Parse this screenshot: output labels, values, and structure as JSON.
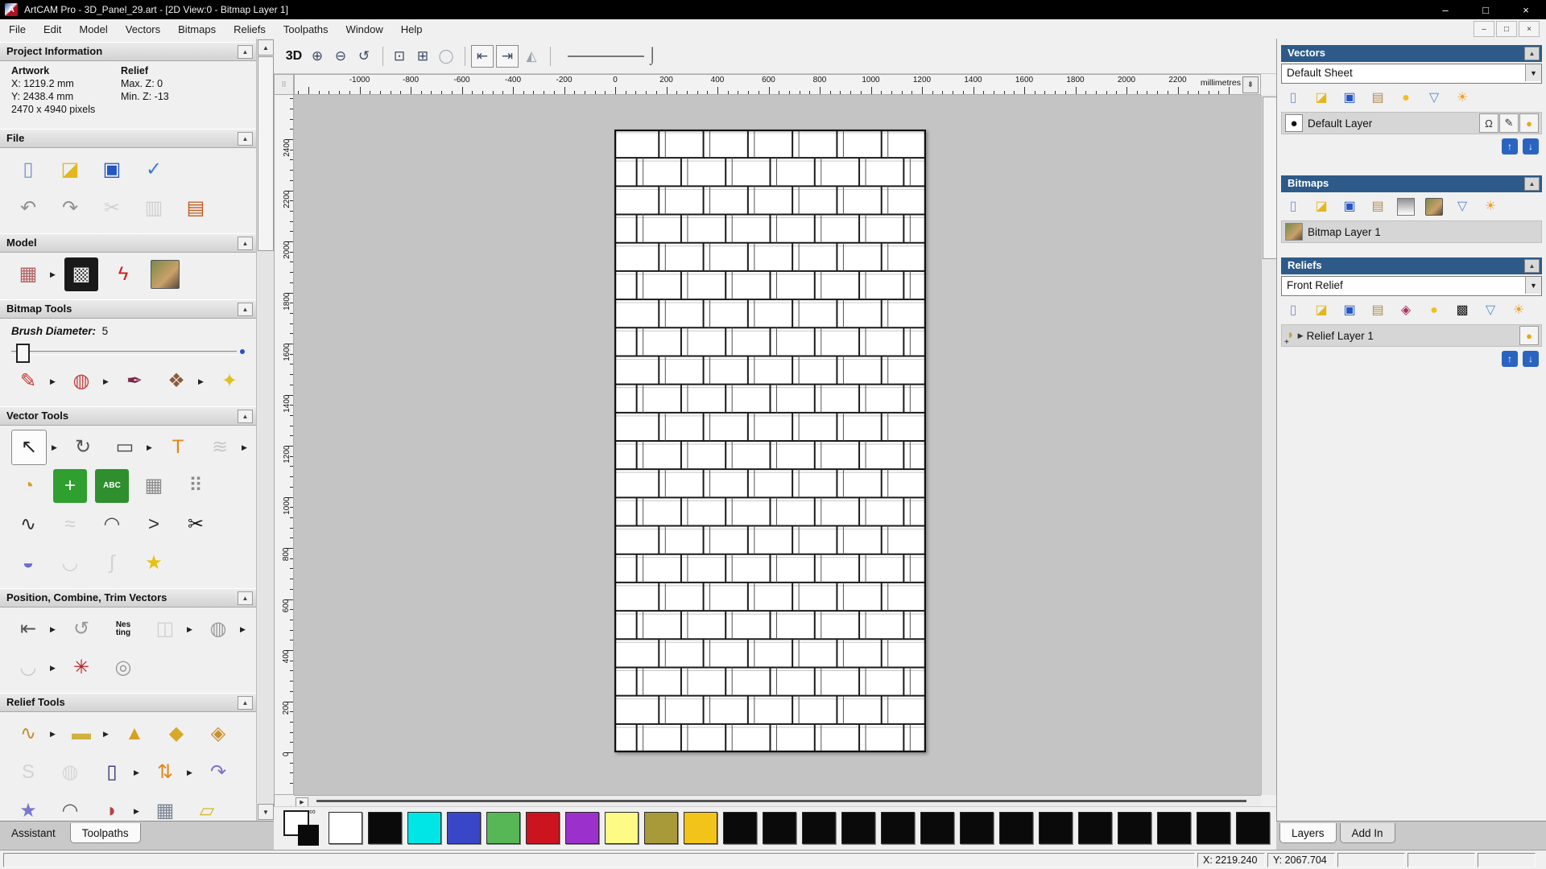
{
  "window": {
    "title": "ArtCAM Pro - 3D_Panel_29.art - [2D View:0 - Bitmap Layer 1]",
    "logo_letter": "A",
    "minimize": "–",
    "maximize": "□",
    "close": "×"
  },
  "menu": {
    "items": [
      "File",
      "Edit",
      "Model",
      "Vectors",
      "Bitmaps",
      "Reliefs",
      "Toolpaths",
      "Window",
      "Help"
    ],
    "mdi": [
      "–",
      "□",
      "×"
    ]
  },
  "assistant": {
    "project_information": {
      "title": "Project Information",
      "artwork_label": "Artwork",
      "artwork_x": "X: 1219.2 mm",
      "artwork_y": "Y: 2438.4 mm",
      "artwork_pixels": "2470 x 4940 pixels",
      "relief_label": "Relief",
      "relief_max": "Max. Z: 0",
      "relief_min": "Min. Z: -13"
    },
    "sections": {
      "file": {
        "title": "File",
        "rows": [
          [
            {
              "n": "new-model",
              "g": "▯",
              "c": "#7b96c8"
            },
            {
              "n": "open-model",
              "g": "◪",
              "c": "#e3b71e"
            },
            {
              "n": "save-model",
              "g": "▣",
              "c": "#2456c4"
            },
            {
              "n": "model-options",
              "g": "✓",
              "c": "#3f7ad0"
            }
          ],
          [
            {
              "n": "undo",
              "g": "↶",
              "c": "#909090"
            },
            {
              "n": "redo",
              "g": "↷",
              "c": "#909090"
            },
            {
              "n": "cut",
              "g": "✂",
              "c": "#aaaaaa",
              "dim": 1
            },
            {
              "n": "copy",
              "g": "▥",
              "c": "#aaaaaa",
              "dim": 1
            },
            {
              "n": "paste",
              "g": "▤",
              "c": "#c25a20"
            }
          ]
        ]
      },
      "model": {
        "title": "Model",
        "rows": [
          [
            {
              "n": "set-model-size",
              "g": "▦",
              "c": "#b06060",
              "fly": 1
            },
            {
              "n": "invert-model",
              "g": "▩",
              "c": "#f0f0f0",
              "bg": "#1a1a1a"
            },
            {
              "n": "set-lighting",
              "g": "ϟ",
              "c": "#cc2020"
            },
            {
              "n": "load-image",
              "art": 1
            }
          ]
        ]
      },
      "bitmap_tools": {
        "title": "Bitmap Tools",
        "brush_label": "Brush Diameter:",
        "brush_value": "5",
        "rows": [
          [
            {
              "n": "paint-tool",
              "g": "✎",
              "c": "#c43030",
              "fly": 1
            },
            {
              "n": "flood-fill",
              "g": "◍",
              "c": "#c44040",
              "fly": 1
            },
            {
              "n": "colour-picker",
              "g": "✒",
              "c": "#7a2a4a"
            },
            {
              "n": "colour-palette",
              "g": "❖",
              "c": "#8a5a3a",
              "fly": 1
            },
            {
              "n": "magic-wand",
              "g": "✦",
              "c": "#e0c020"
            }
          ]
        ]
      },
      "vector_tools": {
        "title": "Vector Tools",
        "rows": [
          [
            {
              "n": "select-vectors",
              "g": "↖",
              "c": "#222222",
              "active": 1,
              "fly": 1
            },
            {
              "n": "transform-vectors",
              "g": "↻",
              "c": "#555555"
            },
            {
              "n": "create-rectangle",
              "g": "▭",
              "c": "#444444",
              "fly": 1
            },
            {
              "n": "create-text",
              "g": "T",
              "c": "#e08818"
            },
            {
              "n": "fit-vectors-to-bitmap",
              "g": "≋",
              "c": "#999999",
              "dim": 1,
              "fly": 1
            }
          ],
          [
            {
              "n": "measure-tool",
              "g": "◔",
              "c": "#d8a020"
            },
            {
              "n": "block-copy-rotate",
              "g": "+",
              "c": "#ffffff",
              "bg": "#2f9f2f"
            },
            {
              "n": "paste-text",
              "txt": "ABC",
              "bg": "#2f8f2f",
              "c": "#ffffff"
            },
            {
              "n": "envelope-distortion",
              "g": "▦",
              "c": "#8a8a8a"
            },
            {
              "n": "block-paste",
              "g": "⠿",
              "c": "#8a8a8a"
            }
          ],
          [
            {
              "n": "create-polyline",
              "g": "∿",
              "c": "#333333"
            },
            {
              "n": "freehand-draw",
              "g": "≈",
              "c": "#aaaaaa",
              "dim": 1
            },
            {
              "n": "create-arc",
              "g": "◠",
              "c": "#444444"
            },
            {
              "n": "sharpen-corner",
              "g": ">",
              "c": "#333333"
            },
            {
              "n": "trim-vectors",
              "g": "✂",
              "c": "#111111"
            }
          ],
          [
            {
              "n": "create-boundary",
              "g": "◒",
              "c": "#6a6ad0"
            },
            {
              "n": "fit-arcs",
              "g": "◡",
              "c": "#aaaaaa",
              "dim": 1
            },
            {
              "n": "join-vectors",
              "g": "∫",
              "c": "#aaaaaa",
              "dim": 1
            },
            {
              "n": "create-star",
              "g": "★",
              "c": "#e8c010"
            }
          ]
        ]
      },
      "position_vectors": {
        "title": "Position, Combine, Trim Vectors",
        "rows": [
          [
            {
              "n": "align-vectors",
              "g": "⇤",
              "c": "#555555",
              "fly": 1
            },
            {
              "n": "text-on-curve",
              "g": "↺",
              "c": "#999999"
            },
            {
              "n": "nesting",
              "txt": "Nes\nting",
              "c": "#111111"
            },
            {
              "n": "group-vectors",
              "g": "◫",
              "c": "#aaaaaa",
              "dim": 1,
              "fly": 1
            },
            {
              "n": "weld-vectors",
              "g": "◍",
              "c": "#999999",
              "fly": 1
            }
          ],
          [
            {
              "n": "fillet-tool",
              "g": "◡",
              "c": "#999999",
              "dim": 1,
              "fly": 1
            },
            {
              "n": "vector-texture",
              "g": "✳",
              "c": "#bb2222"
            },
            {
              "n": "interlocking-vectors",
              "g": "◎",
              "c": "#999999"
            }
          ]
        ]
      },
      "relief_tools": {
        "title": "Relief Tools",
        "rows": [
          [
            {
              "n": "smooth-relief",
              "g": "∿",
              "c": "#c09030",
              "fly": 1
            },
            {
              "n": "zero-plane",
              "g": "▬",
              "c": "#d0b040",
              "fly": 1
            },
            {
              "n": "add-relief",
              "g": "▲",
              "c": "#d8a020"
            },
            {
              "n": "merge-highest",
              "g": "◆",
              "c": "#d8a828"
            },
            {
              "n": "merge-lowest",
              "g": "◈",
              "c": "#c89030"
            }
          ],
          [
            {
              "n": "sculpt",
              "g": "S",
              "c": "#b0b0b0",
              "dim": 1
            },
            {
              "n": "celtic-weave",
              "g": "◍",
              "c": "#b8b8b8",
              "dim": 1
            },
            {
              "n": "offset-relief",
              "g": "▯",
              "c": "#32327a",
              "fly": 1
            },
            {
              "n": "scale-relief-height",
              "g": "⇅",
              "c": "#e08818",
              "fly": 1
            },
            {
              "n": "relief-envelope",
              "g": "↷",
              "c": "#8070c8"
            }
          ],
          [
            {
              "n": "shape-editor",
              "g": "★",
              "c": "#7878d0"
            },
            {
              "n": "two-rail-sweep",
              "g": "◠",
              "c": "#555555"
            },
            {
              "n": "extrude-relief",
              "g": "◗",
              "c": "#b84040",
              "fly": 1
            },
            {
              "n": "texture-relief",
              "g": "▦",
              "c": "#7a8494"
            },
            {
              "n": "relief-layer-stack",
              "g": "▱",
              "c": "#d0b830"
            }
          ],
          [
            {
              "n": "angled-plane",
              "g": "◢",
              "c": "#bb2020"
            },
            {
              "n": "relief-weave",
              "g": "▦",
              "c": "#909090"
            },
            {
              "n": "smooth-blend",
              "g": "◉",
              "c": "#8888cc"
            },
            {
              "n": "textured-sphere",
              "g": "●",
              "c": "#3a5ac0"
            },
            {
              "n": "relief-split",
              "g": "❖",
              "c": "#c0a020"
            }
          ]
        ]
      }
    },
    "tabs": [
      {
        "label": "Assistant",
        "active": true
      },
      {
        "label": "Toolpaths",
        "active": false
      }
    ]
  },
  "view_toolbar": {
    "buttons": [
      {
        "t": "btn",
        "n": "view-3d",
        "label": "3D"
      },
      {
        "t": "btn",
        "n": "zoom-in",
        "g": "⊕"
      },
      {
        "t": "btn",
        "n": "zoom-out",
        "g": "⊖"
      },
      {
        "t": "btn",
        "n": "zoom-previous",
        "g": "↺"
      },
      {
        "t": "sep"
      },
      {
        "t": "btn",
        "n": "zoom-box",
        "g": "⊡"
      },
      {
        "t": "btn",
        "n": "zoom-fit",
        "g": "⊞"
      },
      {
        "t": "btn",
        "n": "zoom-selection",
        "g": "◯",
        "dim": 1
      },
      {
        "t": "sep"
      },
      {
        "t": "btn",
        "n": "previous-bitmap-layer",
        "g": "⇤",
        "boxed": 1
      },
      {
        "t": "btn",
        "n": "next-bitmap-layer",
        "g": "⇥",
        "boxed": 1
      },
      {
        "t": "btn",
        "n": "preview-relief",
        "g": "◭",
        "dim": 1
      },
      {
        "t": "sep"
      },
      {
        "t": "slider",
        "n": "line-width-slider"
      }
    ]
  },
  "ruler": {
    "unit": "millimetres",
    "h_labels": [
      -1000,
      -800,
      -600,
      -400,
      -200,
      0,
      200,
      400,
      600,
      800,
      1000,
      1200,
      1400,
      1600,
      1800,
      2000,
      2200
    ],
    "v_labels": [
      2400,
      2200,
      2000,
      1800,
      1600,
      1400,
      1200,
      1000,
      800,
      600,
      400,
      200,
      0
    ]
  },
  "canvas": {
    "weave": {
      "rows": 22,
      "cols": 7
    }
  },
  "palette": {
    "primary": "#ffffff",
    "secondary": "#0a0a0a",
    "swatches": [
      "#ffffff",
      "#0a0a0a",
      "#00e6e6",
      "#3a46c8",
      "#57b757",
      "#cc1420",
      "#9b30cc",
      "#fdfa86",
      "#a89a38",
      "#f2c41a",
      "#0a0a0a",
      "#0a0a0a",
      "#0a0a0a",
      "#0a0a0a",
      "#0a0a0a",
      "#0a0a0a",
      "#0a0a0a",
      "#0a0a0a",
      "#0a0a0a",
      "#0a0a0a",
      "#0a0a0a",
      "#0a0a0a",
      "#0a0a0a",
      "#0a0a0a"
    ]
  },
  "layers_panel": {
    "vectors": {
      "title": "Vectors",
      "sheet": "Default Sheet",
      "toolbar": [
        [
          {
            "n": "new-vector-layer",
            "g": "▯",
            "c": "#7b96c8"
          },
          {
            "n": "open-vector-layer",
            "g": "◪",
            "c": "#e3b71e"
          },
          {
            "n": "save-vector-layer",
            "g": "▣",
            "c": "#2456c4"
          },
          {
            "n": "merge-vector-layers",
            "g": "▤",
            "c": "#b08a50"
          },
          {
            "n": "toggle-layer-visibility",
            "g": "●",
            "c": "#f0c020"
          },
          {
            "n": "delete-vector-layer",
            "g": "▽",
            "c": "#5588cc"
          },
          {
            "n": "toggle-all-layers",
            "g": "☀",
            "c": "#f0a020"
          }
        ]
      ],
      "layer_name": "Default Layer"
    },
    "bitmaps": {
      "title": "Bitmaps",
      "toolbar": [
        [
          {
            "n": "new-bitmap-layer",
            "g": "▯",
            "c": "#7b96c8"
          },
          {
            "n": "open-bitmap-layer",
            "g": "◪",
            "c": "#e3b71e"
          },
          {
            "n": "save-bitmap-layer",
            "g": "▣",
            "c": "#2456c4"
          },
          {
            "n": "merge-bitmap-layers",
            "g": "▤",
            "c": "#b08a50"
          },
          {
            "n": "colour-fade",
            "grad": 1
          },
          {
            "n": "bitmap-fill",
            "art": 1
          },
          {
            "n": "delete-bitmap-layer",
            "g": "▽",
            "c": "#5588cc"
          },
          {
            "n": "toggle-all-bitmaps",
            "g": "☀",
            "c": "#f0a020"
          }
        ]
      ],
      "layer_name": "Bitmap Layer 1"
    },
    "reliefs": {
      "title": "Reliefs",
      "dropdown": "Front Relief",
      "toolbar": [
        [
          {
            "n": "new-relief-layer",
            "g": "▯",
            "c": "#7b96c8"
          },
          {
            "n": "open-relief-layer",
            "g": "◪",
            "c": "#e3b71e"
          },
          {
            "n": "save-relief-layer",
            "g": "▣",
            "c": "#2456c4"
          },
          {
            "n": "merge-relief-layers",
            "g": "▤",
            "c": "#b08a50"
          },
          {
            "n": "stack-reliefs",
            "g": "◈",
            "c": "#aa3060"
          },
          {
            "n": "toggle-relief-visibility",
            "g": "●",
            "c": "#f0c020"
          },
          {
            "n": "relief-texture",
            "g": "▩",
            "c": "#111111"
          },
          {
            "n": "delete-relief-layer",
            "g": "▽",
            "c": "#5588cc"
          },
          {
            "n": "toggle-all-reliefs",
            "g": "☀",
            "c": "#f0a020"
          }
        ]
      ],
      "layer_name": "Relief Layer 1"
    },
    "tabs": [
      {
        "label": "Layers",
        "active": true
      },
      {
        "label": "Add In",
        "active": false
      }
    ]
  },
  "statusbar": {
    "x": "X: 2219.240",
    "y": "Y: 2067.704"
  }
}
